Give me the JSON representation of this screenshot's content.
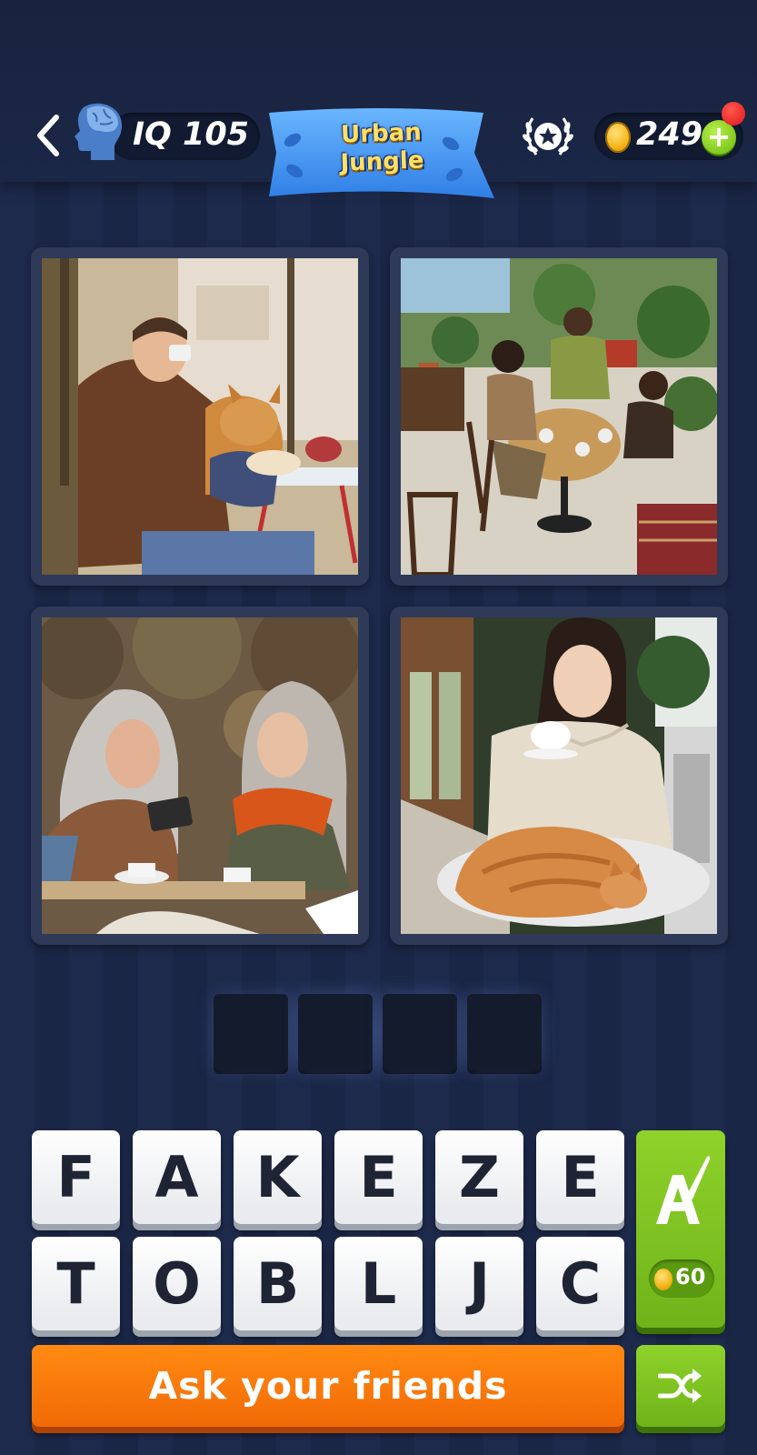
{
  "header": {
    "iq_label": "IQ 105",
    "level_banner": {
      "line1": "Urban",
      "line2": "Jungle"
    },
    "coins": "249",
    "icons": [
      "back-arrow-icon",
      "brain-head-icon",
      "laurel-star-icon",
      "coin-icon",
      "plus-icon"
    ]
  },
  "puzzle": {
    "images": [
      {
        "name": "man-with-corgi-cafe"
      },
      {
        "name": "friends-plant-cafe"
      },
      {
        "name": "women-outdoor-cafe"
      },
      {
        "name": "woman-tea-cat"
      }
    ],
    "answer_slots": [
      "",
      "",
      "",
      ""
    ]
  },
  "keyboard": {
    "row1": [
      "F",
      "A",
      "K",
      "E",
      "Z",
      "E"
    ],
    "row2": [
      "T",
      "O",
      "B",
      "L",
      "J",
      "C"
    ]
  },
  "hint": {
    "cost": "60"
  },
  "actions": {
    "ask_friends": "Ask your friends"
  },
  "colors": {
    "background": "#1d2a4c",
    "accent_orange": "#f57a0a",
    "accent_green": "#7dc220",
    "banner_blue": "#3a8ef0",
    "banner_text": "#ffe066"
  }
}
